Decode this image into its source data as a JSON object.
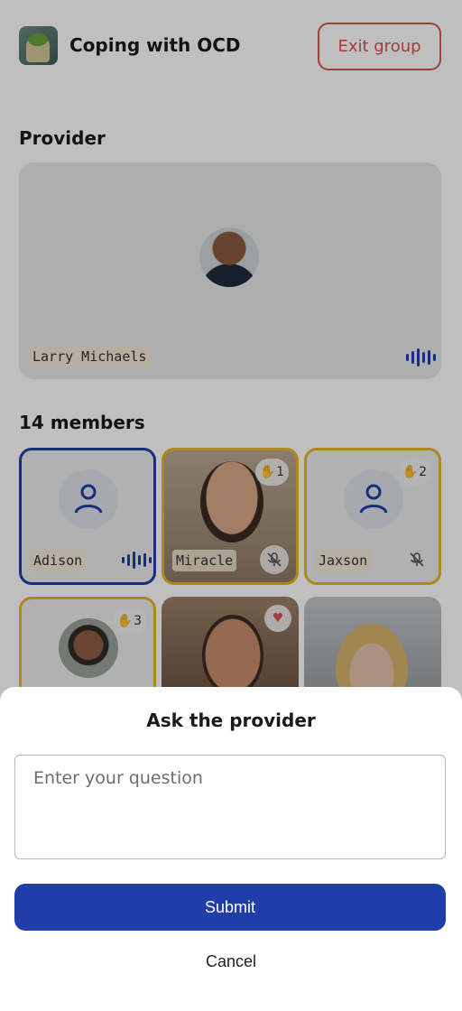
{
  "header": {
    "title": "Coping with OCD",
    "exit_label": "Exit group"
  },
  "provider_section": {
    "title": "Provider",
    "provider_name": "Larry Michaels"
  },
  "members_section": {
    "title": "14 members",
    "members": [
      {
        "name": "Adison"
      },
      {
        "name": "Miracle",
        "hand_count": "1"
      },
      {
        "name": "Jaxson",
        "hand_count": "2"
      },
      {
        "name": "",
        "hand_count": "3"
      }
    ]
  },
  "sheet": {
    "title": "Ask the provider",
    "question_placeholder": "Enter your question",
    "question_value": "",
    "submit_label": "Submit",
    "cancel_label": "Cancel"
  },
  "colors": {
    "primary": "#1f3ea8",
    "exit": "#d9534f",
    "raised_hand": "#e7b623"
  }
}
